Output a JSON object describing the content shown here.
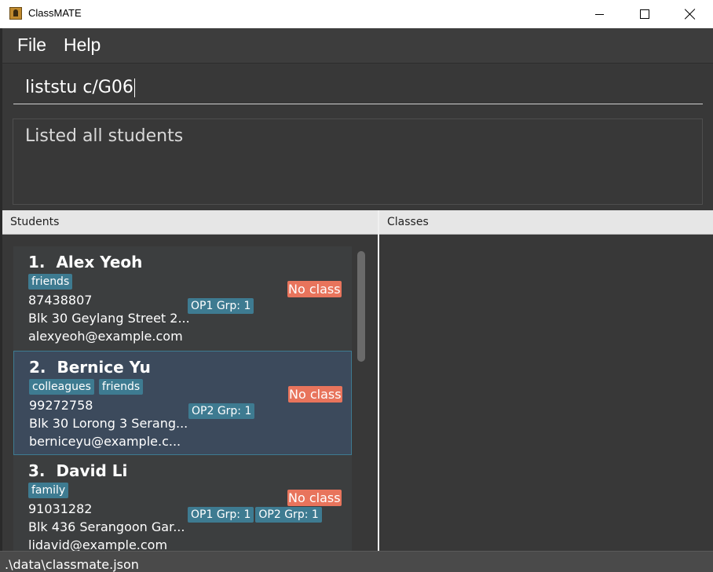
{
  "window": {
    "title": "ClassMATE",
    "icon": "app-icon",
    "controls": [
      "minimize-icon",
      "maximize-icon",
      "close-icon"
    ]
  },
  "menu": {
    "file": "File",
    "help": "Help"
  },
  "command": {
    "value": "liststu c/G06"
  },
  "result": {
    "message": "Listed all students"
  },
  "panels": {
    "students_header": "Students",
    "classes_header": "Classes"
  },
  "students": [
    {
      "index": "1.",
      "name": "Alex Yeoh",
      "tags": [
        "friends"
      ],
      "phone": "87438807",
      "address": "Blk 30 Geylang Street 2...",
      "email": "alexyeoh@example.com",
      "groups": [
        "OP1 Grp: 1"
      ],
      "class_status": "No class"
    },
    {
      "index": "2.",
      "name": "Bernice Yu",
      "tags": [
        "colleagues",
        "friends"
      ],
      "phone": "99272758",
      "address": "Blk 30 Lorong 3 Serang...",
      "email": "berniceyu@example.c...",
      "groups": [
        "OP2 Grp: 1"
      ],
      "class_status": "No class",
      "selected": true
    },
    {
      "index": "3.",
      "name": "David Li",
      "tags": [
        "family"
      ],
      "phone": "91031282",
      "address": "Blk 436 Serangoon Gar...",
      "email": "lidavid@example.com",
      "groups": [
        "OP1 Grp: 1",
        "OP2 Grp: 1"
      ],
      "class_status": "No class"
    }
  ],
  "status_bar": {
    "path": ".\\data\\classmate.json"
  },
  "colors": {
    "tag": "#3e7b91",
    "no_class": "#e8745c",
    "selected_card": "#3c4a5c",
    "background": "#383838"
  }
}
